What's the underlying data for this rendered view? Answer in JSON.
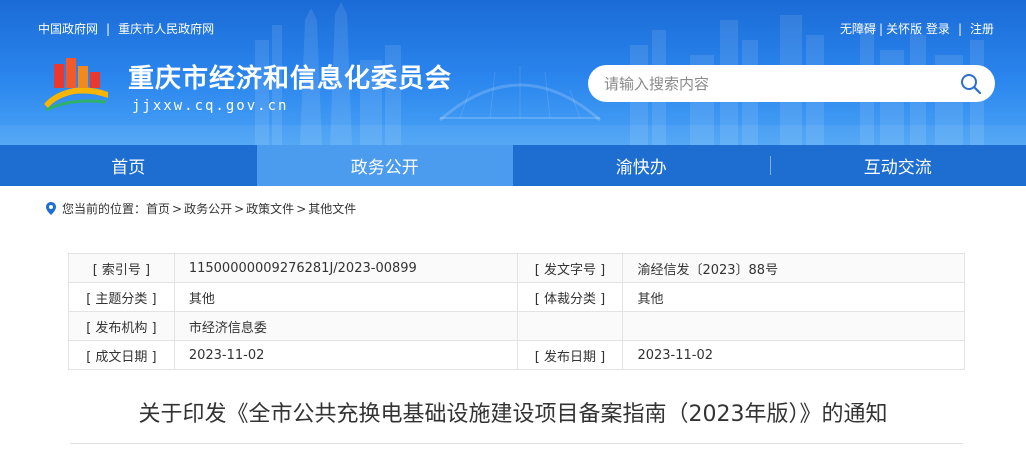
{
  "topbar": {
    "left_links": [
      "中国政府网",
      "重庆市人民政府网"
    ],
    "separator": "|",
    "accessibility": "无障碍",
    "elderly_mode": "关怀版",
    "login": "登录",
    "register": "注册"
  },
  "site": {
    "title": "重庆市经济和信息化委员会",
    "domain": "jjxxw.cq.gov.cn"
  },
  "search": {
    "placeholder": "请输入搜索内容",
    "icon": "search-icon"
  },
  "nav": {
    "items": [
      "首页",
      "政务公开",
      "渝快办",
      "互动交流"
    ],
    "active": "政务公开"
  },
  "breadcrumb": {
    "prefix": "您当前的位置：",
    "items": [
      "首页",
      "政务公开",
      "政策文件",
      "其他文件"
    ],
    "separator": ">"
  },
  "meta": {
    "index_label": "[ 索引号 ]",
    "index_value": "11500000009276281J/2023-00899",
    "docno_label": "[ 发文字号 ]",
    "docno_value": "渝经信发〔2023〕88号",
    "topic_label": "[ 主题分类 ]",
    "topic_value": "其他",
    "genre_label": "[ 体裁分类 ]",
    "genre_value": "其他",
    "issuer_label": "[ 发布机构 ]",
    "issuer_value": "市经济信息委",
    "written_label": "[ 成文日期 ]",
    "written_value": "2023-11-02",
    "published_label": "[ 发布日期 ]",
    "published_value": "2023-11-02"
  },
  "document": {
    "title": "关于印发《全市公共充换电基础设施建设项目备案指南（2023年版）》的通知"
  },
  "colors": {
    "header_top": "#1b6bd6",
    "header_bottom": "#4aa3f5",
    "nav_bg": "#1d6ed0",
    "nav_active": "#4b9bef"
  }
}
